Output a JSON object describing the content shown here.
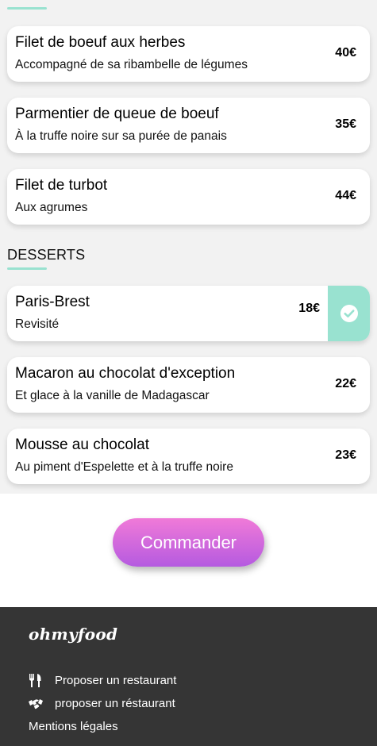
{
  "menu": {
    "mains": [
      {
        "name": "Filet de boeuf aux herbes",
        "description": "Accompagné de sa ribambelle de légumes",
        "price": "40€",
        "selected": false
      },
      {
        "name": "Parmentier de queue de boeuf",
        "description": "À la truffe noire sur sa purée de panais",
        "price": "35€",
        "selected": false
      },
      {
        "name": "Filet de turbot",
        "description": "Aux agrumes",
        "price": "44€",
        "selected": false
      }
    ],
    "desserts_title": "DESSERTS",
    "desserts": [
      {
        "name": "Paris-Brest",
        "description": "Revisité",
        "price": "18€",
        "selected": true
      },
      {
        "name": "Macaron au chocolat d'exception",
        "description": "Et glace à la vanille de Madagascar",
        "price": "22€",
        "selected": false
      },
      {
        "name": "Mousse au chocolat",
        "description": "Au piment d'Espelette et à la truffe noire",
        "price": "23€",
        "selected": false
      }
    ]
  },
  "order": {
    "button_label": "Commander"
  },
  "footer": {
    "logo": "ohmyfood",
    "links": [
      {
        "label": "Proposer un restaurant",
        "icon": "utensils-icon"
      },
      {
        "label": "proposer un réstaurant",
        "icon": "handshake-icon"
      },
      {
        "label": "Mentions légales",
        "icon": ""
      }
    ]
  },
  "colors": {
    "accent": "#99e2d0",
    "button_gradient_top": "#f07ad8",
    "button_gradient_bottom": "#b55ae0",
    "footer_bg": "#353535"
  }
}
